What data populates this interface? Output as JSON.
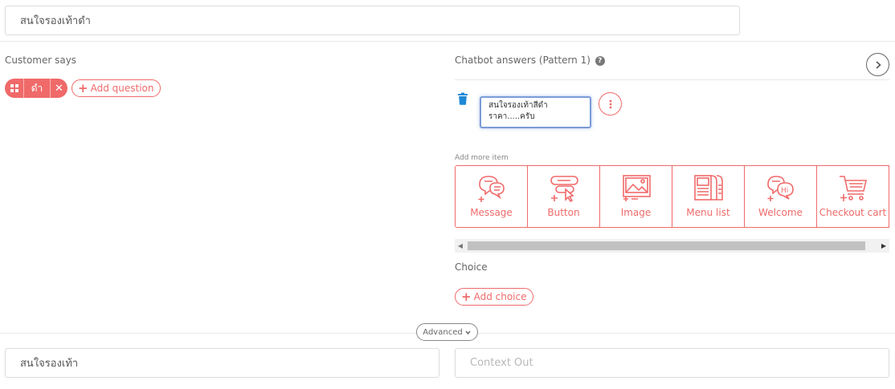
{
  "intent": {
    "name_value": "สนใจรองเท้าดำ"
  },
  "customer": {
    "label": "Customer says",
    "keywords": [
      {
        "text": "ดำ"
      }
    ],
    "add_question_label": "Add question"
  },
  "chatbot": {
    "label": "Chatbot answers (Pattern 1)",
    "help_icon": "?",
    "answer_text": "สนใจรองเท้าสีดำ\nราคา.....ครับ",
    "add_more_label": "Add more item",
    "items": [
      {
        "label": "Message",
        "icon": "message-icon"
      },
      {
        "label": "Button",
        "icon": "button-icon"
      },
      {
        "label": "Image",
        "icon": "image-icon"
      },
      {
        "label": "Menu list",
        "icon": "menu-list-icon"
      },
      {
        "label": "Welcome",
        "icon": "welcome-icon"
      },
      {
        "label": "Checkout cart",
        "icon": "checkout-cart-icon"
      }
    ],
    "choice_label": "Choice",
    "add_choice_label": "Add choice"
  },
  "advanced": {
    "label": "Advanced"
  },
  "context": {
    "in_value": "สนใจรองเท้า",
    "out_placeholder": "Context Out"
  },
  "colors": {
    "accent": "#f06a6a",
    "trash": "#1e88d6",
    "focus": "#7a9cd6"
  }
}
